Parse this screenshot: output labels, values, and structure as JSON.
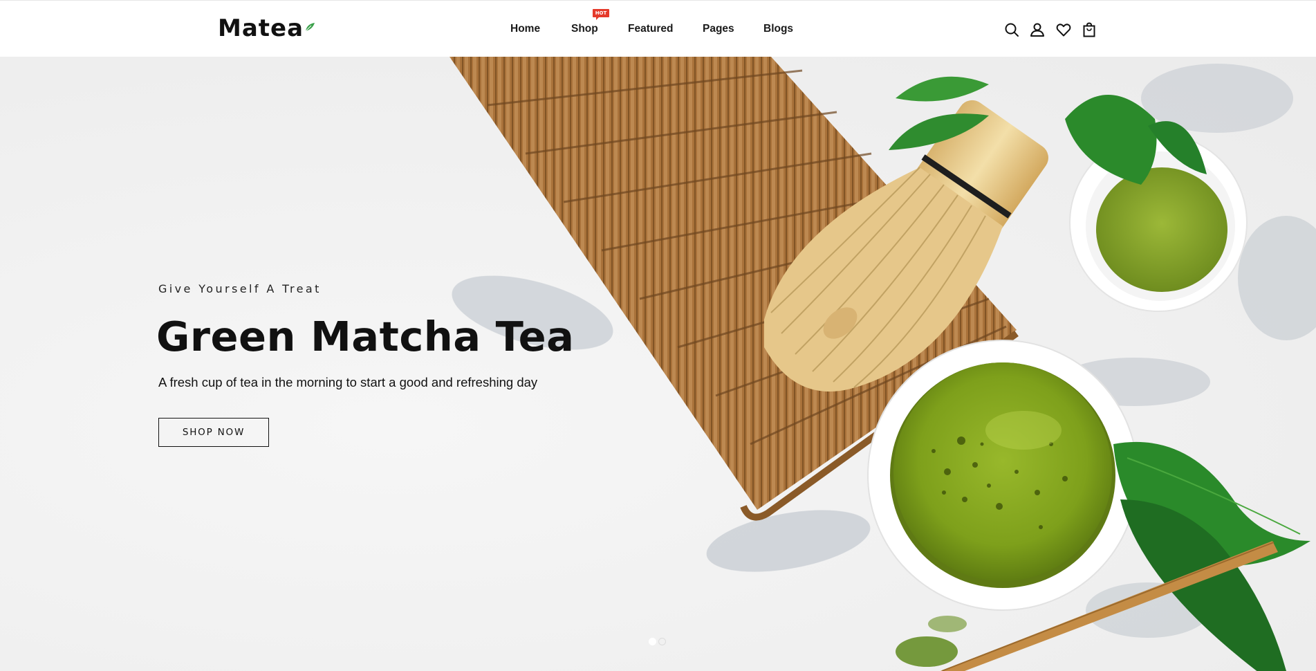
{
  "brand": {
    "name": "Matea",
    "accent": "#3aa04a"
  },
  "nav": {
    "items": [
      {
        "label": "Home"
      },
      {
        "label": "Shop",
        "badge": "HOT"
      },
      {
        "label": "Featured"
      },
      {
        "label": "Pages"
      },
      {
        "label": "Blogs"
      }
    ]
  },
  "header_icons": [
    "search-icon",
    "user-icon",
    "heart-icon",
    "shopping-bag-icon"
  ],
  "hero": {
    "subtitle": "Give Yourself A Treat",
    "title": "Green Matcha Tea",
    "description": "A fresh cup of tea in the morning to start a good and refreshing day",
    "button_label": "SHOP NOW",
    "slides": {
      "count": 2,
      "active": 1
    }
  },
  "colors": {
    "badge": "#e53a2b",
    "text": "#111111",
    "matcha": "#7fa21c",
    "leaf": "#2e8a2e",
    "bamboo": "#b67a3c"
  }
}
